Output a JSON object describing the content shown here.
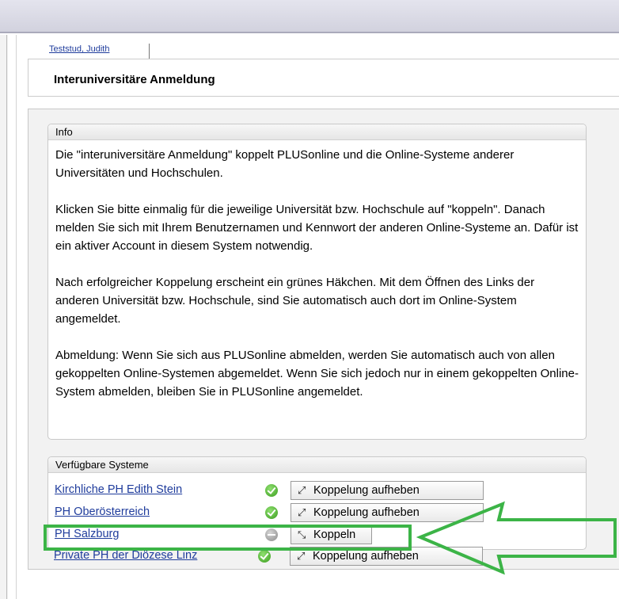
{
  "user_tab": {
    "label": "Teststud, Judith"
  },
  "page_title": "Interuniversitäre Anmeldung",
  "info": {
    "title": "Info",
    "paragraphs": [
      "Die \"interuniversitäre Anmeldung\" koppelt PLUSonline und die Online-Systeme anderer Universitäten und Hochschulen.",
      "Klicken Sie bitte einmalig für die jeweilige Universität bzw. Hochschule auf \"koppeln\". Danach melden Sie sich mit Ihrem Benutzernamen und Kennwort der anderen Online-Systeme an. Dafür ist ein aktiver Account in diesem System notwendig.",
      "Nach erfolgreicher Koppelung erscheint ein grünes Häkchen. Mit dem Öffnen des Links der anderen Universität bzw. Hochschule, sind Sie automatisch auch dort im Online-System angemeldet.",
      "Abmeldung: Wenn Sie sich aus PLUSonline abmelden, werden Sie automatisch auch von allen gekoppelten Online-Systemen abgemeldet. Wenn Sie sich jedoch nur in einem gekoppelten Online-System abmelden, bleiben Sie in PLUSonline angemeldet."
    ]
  },
  "systems": {
    "title": "Verfügbare Systeme",
    "rows": [
      {
        "name": "Kirchliche PH Edith Stein",
        "status": "check-icon",
        "button": "Koppelung aufheben",
        "button_icon": "⤢"
      },
      {
        "name": "PH Oberösterreich",
        "status": "check-icon",
        "button": "Koppelung aufheben",
        "button_icon": "⤢"
      },
      {
        "name": "PH Salzburg",
        "status": "minus-icon",
        "button": "Koppeln",
        "button_icon": "⤡"
      },
      {
        "name": "Private PH der Diözese Linz",
        "status": "check-icon",
        "button": "Koppelung aufheben",
        "button_icon": "⤢"
      }
    ]
  },
  "colors": {
    "link": "#1f3c9c",
    "highlight": "#3cb447",
    "ok": "#3b9c1f"
  }
}
